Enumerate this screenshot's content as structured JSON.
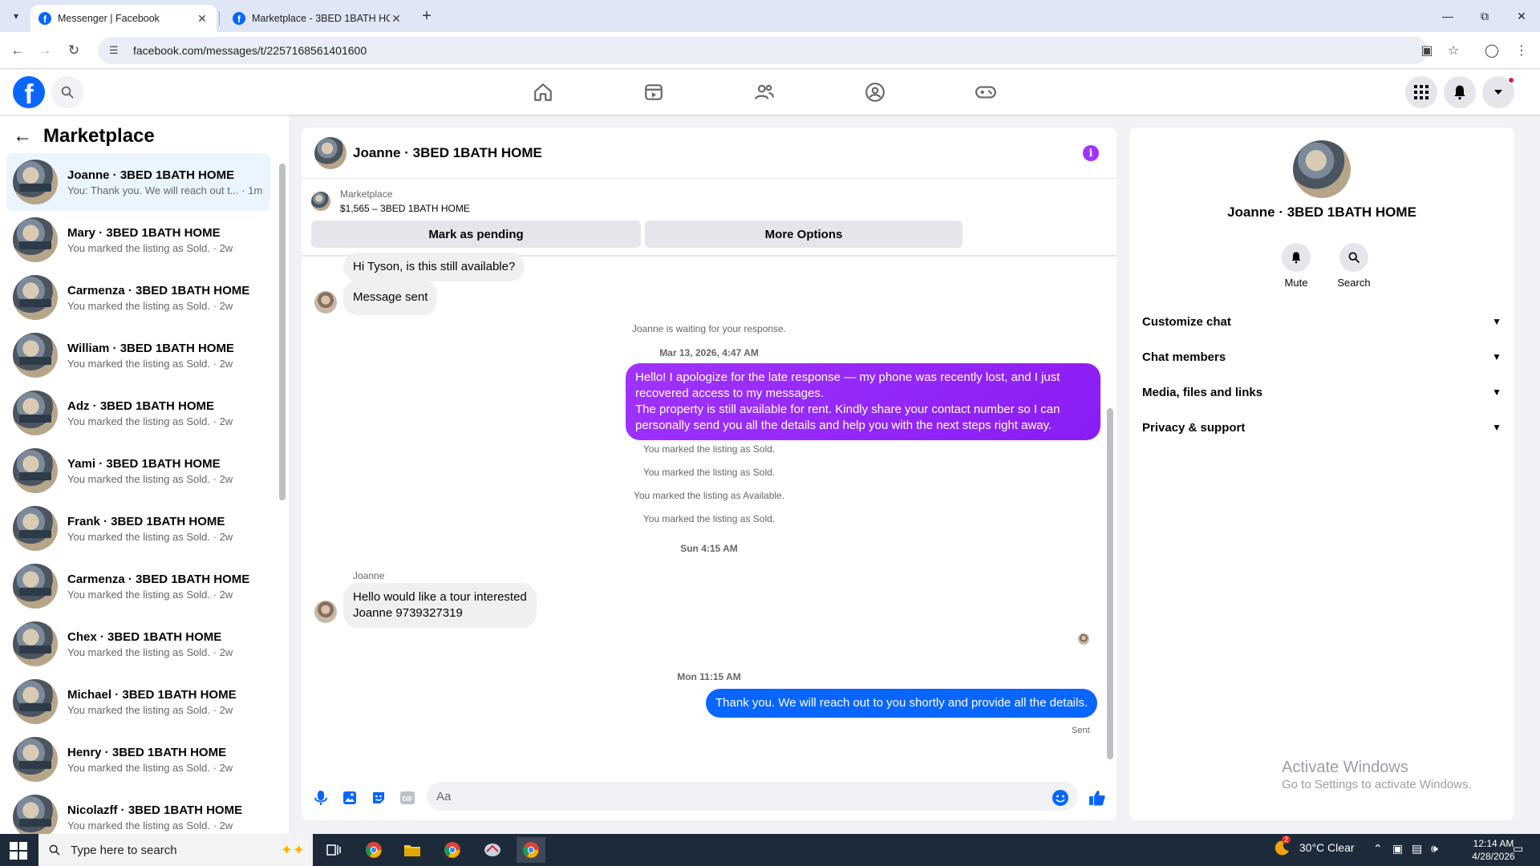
{
  "browser": {
    "tabs": [
      {
        "title": "Messenger | Facebook",
        "active": true
      },
      {
        "title": "Marketplace - 3BED 1BATH HOME",
        "active": false
      }
    ],
    "url": "facebook.com/messages/t/2257168561401600"
  },
  "sidebar": {
    "title": "Marketplace",
    "conversations": [
      {
        "name": "Joanne · 3BED 1BATH HOME",
        "preview": "You: Thank you. We will reach out t... · 1m",
        "active": true
      },
      {
        "name": "Mary · 3BED 1BATH HOME",
        "preview": "You marked the listing as Sold. · 2w"
      },
      {
        "name": "Carmenza · 3BED 1BATH HOME",
        "preview": "You marked the listing as Sold. · 2w"
      },
      {
        "name": "William · 3BED 1BATH HOME",
        "preview": "You marked the listing as Sold. · 2w"
      },
      {
        "name": "Adz · 3BED 1BATH HOME",
        "preview": "You marked the listing as Sold. · 2w"
      },
      {
        "name": "Yami · 3BED 1BATH HOME",
        "preview": "You marked the listing as Sold. · 2w"
      },
      {
        "name": "Frank · 3BED 1BATH HOME",
        "preview": "You marked the listing as Sold. · 2w"
      },
      {
        "name": "Carmenza · 3BED 1BATH HOME",
        "preview": "You marked the listing as Sold. · 2w"
      },
      {
        "name": "Chex · 3BED 1BATH HOME",
        "preview": "You marked the listing as Sold. · 2w"
      },
      {
        "name": "Michael · 3BED 1BATH HOME",
        "preview": "You marked the listing as Sold. · 2w"
      },
      {
        "name": "Henry · 3BED 1BATH HOME",
        "preview": "You marked the listing as Sold. · 2w"
      },
      {
        "name": "Nicolazff · 3BED 1BATH HOME",
        "preview": "You marked the listing as Sold. · 2w"
      }
    ]
  },
  "chat": {
    "title": "Joanne · 3BED 1BATH HOME",
    "marketplace_label": "Marketplace",
    "listing": "$1,565 – 3BED 1BATH HOME",
    "mark_pending": "Mark as pending",
    "more_options": "More Options",
    "msg_hi": "Hi Tyson, is this still available?",
    "msg_sent_auto": "Message sent",
    "waiting": "Joanne is waiting for your response.",
    "ts1": "Mar 13, 2026, 4:47 AM",
    "out1_line1": "Hello! I apologize for the late response — my phone was recently lost, and I just recovered access to my messages.",
    "out1_line2": "The property is still available for rent. Kindly share your contact number so I can personally send you all the details and help you with the next steps right away.",
    "sys1": "You marked the listing as Sold.",
    "sys2": "You marked the listing as Sold.",
    "sys3": "You marked the listing as Available.",
    "sys4": "You marked the listing as Sold.",
    "ts2": "Sun 4:15 AM",
    "sender_joanne": "Joanne",
    "in2_line1": "Hello would like a tour interested",
    "in2_line2": "Joanne 9739327319",
    "ts3": "Mon 11:15 AM",
    "out2": "Thank you. We will reach out to you shortly and provide all the details.",
    "sent_status": "Sent",
    "composer_placeholder": "Aa",
    "outgoing_color": "#0866ff",
    "outgoing_gradient_color": "#8a1cf5"
  },
  "details": {
    "name": "Joanne · 3BED 1BATH HOME",
    "mute": "Mute",
    "search": "Search",
    "sections": [
      "Customize chat",
      "Chat members",
      "Media, files and links",
      "Privacy & support"
    ]
  },
  "watermark": {
    "line1": "Activate Windows",
    "line2": "Go to Settings to activate Windows."
  },
  "taskbar": {
    "search_placeholder": "Type here to search",
    "weather": "30°C  Clear",
    "weather_badge": "2",
    "time": "12:14 AM",
    "date": "4/28/2026"
  }
}
